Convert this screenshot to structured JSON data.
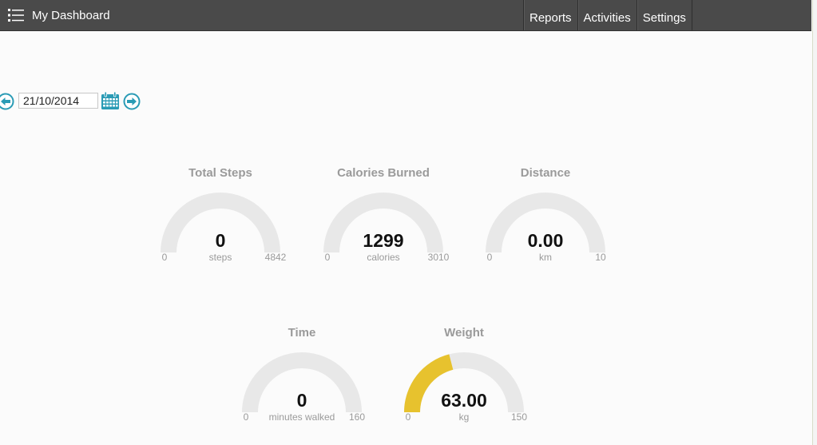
{
  "header": {
    "title": "My Dashboard",
    "nav": [
      {
        "label": "Reports"
      },
      {
        "label": "Activities"
      },
      {
        "label": "Settings"
      }
    ]
  },
  "date_nav": {
    "date": "21/10/2014"
  },
  "colors": {
    "topbar": "#4a4a4a",
    "accent": "#2a9bb5",
    "gauge_track": "#e8e8e8",
    "gauge_fill": "#e7c22e"
  },
  "gauges": [
    {
      "title": "Total Steps",
      "value": "0",
      "unit": "steps",
      "min": "0",
      "max": "4842",
      "fraction": 0
    },
    {
      "title": "Calories Burned",
      "value": "1299",
      "unit": "calories",
      "min": "0",
      "max": "3010",
      "fraction": 0
    },
    {
      "title": "Distance",
      "value": "0.00",
      "unit": "km",
      "min": "0",
      "max": "10",
      "fraction": 0
    },
    {
      "title": "Time",
      "value": "0",
      "unit": "minutes walked",
      "min": "0",
      "max": "160",
      "fraction": 0
    },
    {
      "title": "Weight",
      "value": "63.00",
      "unit": "kg",
      "min": "0",
      "max": "150",
      "fraction": 0.42
    }
  ]
}
